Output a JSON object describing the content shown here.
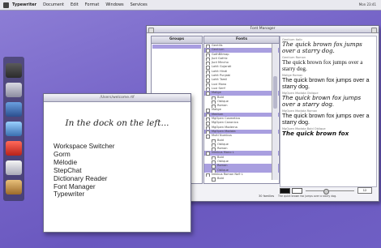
{
  "menubar": {
    "items": [
      "Typewriter",
      "Document",
      "Edit",
      "Format",
      "Windows",
      "Services"
    ],
    "clock": "Mon 23:41"
  },
  "font_manager": {
    "title": "Font Manager",
    "groups_header": "Groups",
    "fonts_header": "Fonts",
    "fonts": [
      {
        "label": "Gentilis",
        "sel": false,
        "sub": false
      },
      {
        "label": "Gentium",
        "sel": true,
        "sub": false
      },
      {
        "label": "GothBitmap",
        "sel": false,
        "sub": false
      },
      {
        "label": "Jscii Gothic",
        "sel": false,
        "sub": false
      },
      {
        "label": "Jscii Mincho",
        "sel": false,
        "sub": false
      },
      {
        "label": "Lohit Gujarati",
        "sel": false,
        "sub": false
      },
      {
        "label": "Lohit Hindi",
        "sel": false,
        "sub": false
      },
      {
        "label": "Lohit Punjabi",
        "sel": false,
        "sub": false
      },
      {
        "label": "Lohit Tamil",
        "sel": false,
        "sub": false
      },
      {
        "label": "Luxi Mono",
        "sel": false,
        "sub": false
      },
      {
        "label": "Luxi Serif",
        "sel": false,
        "sub": false
      },
      {
        "label": "Malige",
        "sel": true,
        "sub": false
      },
      {
        "label": "Bold",
        "sel": false,
        "sub": true
      },
      {
        "label": "Oblique",
        "sel": false,
        "sub": true
      },
      {
        "label": "Roman",
        "sel": false,
        "sub": true
      },
      {
        "label": "Malige",
        "sel": false,
        "sub": false
      },
      {
        "label": "Medium",
        "sel": true,
        "sub": false
      },
      {
        "label": "MgOpen Cosmetica",
        "sel": false,
        "sub": false
      },
      {
        "label": "MgOpen Canonica",
        "sel": false,
        "sub": false
      },
      {
        "label": "MgOpen Moderna",
        "sel": false,
        "sub": false
      },
      {
        "label": "MgOpen Modata",
        "sel": true,
        "sub": false
      },
      {
        "label": "Multi Numbus",
        "sel": false,
        "sub": false
      },
      {
        "label": "Bold",
        "sel": false,
        "sub": true
      },
      {
        "label": "Oblique",
        "sel": false,
        "sub": true
      },
      {
        "label": "Roman",
        "sel": false,
        "sub": true
      },
      {
        "label": "Nimbus Mono L",
        "sel": true,
        "sub": false
      },
      {
        "label": "Bold",
        "sel": false,
        "sub": true
      },
      {
        "label": "Oblique",
        "sel": false,
        "sub": true
      },
      {
        "label": "Roman",
        "sel": true,
        "sub": true
      },
      {
        "label": "Oblique",
        "sel": true,
        "sub": true
      },
      {
        "label": "Nimbus Roman No9 L",
        "sel": false,
        "sub": false
      },
      {
        "label": "Bold",
        "sel": false,
        "sub": true
      }
    ],
    "count_label": "30 families",
    "samples": [
      {
        "caption": "Gentium Italic",
        "text": "The quick brown fox jumps over a starry dog."
      },
      {
        "caption": "Gentium Roman",
        "text": "The quick brown fox jumps over a starry dog."
      },
      {
        "caption": "Malige Roman",
        "text": "The quick brown fox jumps over a starry dog."
      },
      {
        "caption": "MgOpen Modata Oblique",
        "text": "The quick brown fox jumps over a starry dog."
      },
      {
        "caption": "MgOpen Modata Roman",
        "text": "The quick brown fox jumps over a starry dog."
      },
      {
        "caption": "MgOpen Modata Bold Oblique",
        "text": "The quick brown fox"
      }
    ],
    "size_value": "12",
    "bottom_text": "The quick brown fox jumps over a starry dog.",
    "colors": {
      "selection": "#a99fe0",
      "accent": "#7665c8"
    }
  },
  "text_window": {
    "title": "/Users/welcome.rtf",
    "heading": "In the dock on the left...",
    "items": [
      "Workspace Switcher",
      "Gorm",
      "Mélodie",
      "StepChat",
      "Dictionary Reader",
      "Font Manager",
      "Typewriter"
    ]
  },
  "dock": {
    "icons": [
      "terminal-icon",
      "typewriter-icon",
      "pen-tool-icon",
      "globe-icon",
      "font-manager-icon",
      "dictionary-icon",
      "chat-icon"
    ]
  }
}
